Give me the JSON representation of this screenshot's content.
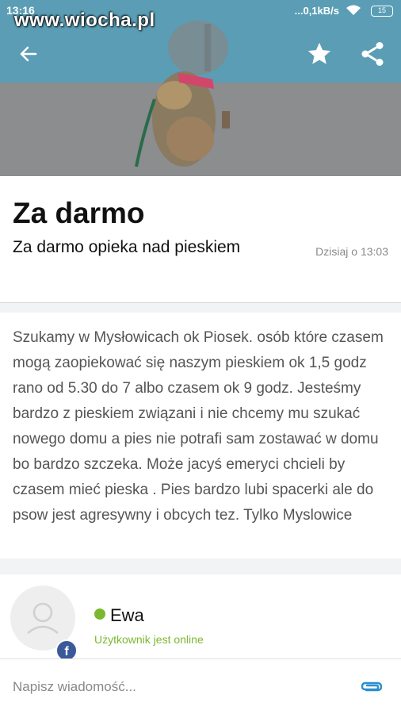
{
  "status_bar": {
    "time": "13:16",
    "network_speed": "...0,1kB/s",
    "battery": "15"
  },
  "watermark": "www.wiocha.pl",
  "toolbar": {
    "back_icon": "arrow-left-icon",
    "favorite_icon": "star-icon",
    "share_icon": "share-icon"
  },
  "listing": {
    "title": "Za darmo",
    "subtitle": "Za darmo opieka nad pieskiem",
    "date": "Dzisiaj o 13:03",
    "description": "Szukamy   w Mysłowicach ok Piosek. osób które czasem mogą zaopiekować się naszym pieskiem ok  1,5 godz rano od  5.30 do 7 albo czasem  ok 9 godz. Jesteśmy bardzo z pieskiem związani i nie chcemy mu szukać nowego domu a pies nie potrafi sam zostawać w domu bo bardzo szczeka.  Może jacyś emeryci chcieli by czasem mieć pieska   . Pies bardzo lubi spacerki ale    do psow jest agresywny i obcych tez. Tylko Myslowice"
  },
  "user": {
    "name": "Ewa",
    "status": "Użytkownik jest online",
    "fb_badge": "f"
  },
  "message": {
    "placeholder": "Napisz wiadomość..."
  },
  "colors": {
    "online": "#7cb82f",
    "accent": "#2a8fd0",
    "facebook": "#3b5998"
  }
}
